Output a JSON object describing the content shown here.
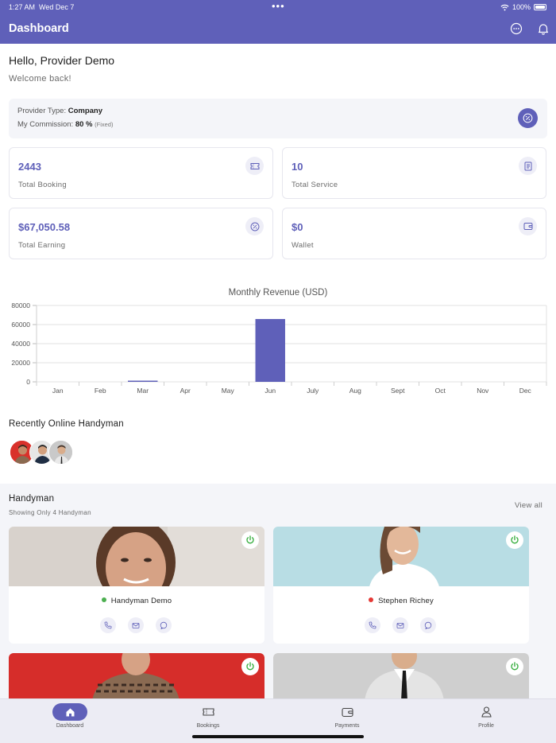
{
  "status_bar": {
    "time": "1:27 AM",
    "date": "Wed Dec 7",
    "battery": "100%"
  },
  "header": {
    "title": "Dashboard"
  },
  "greeting": {
    "hello": "Hello, Provider Demo",
    "welcome": "Welcome back!"
  },
  "provider": {
    "type_label": "Provider Type:",
    "type_value": "Company",
    "commission_label": "My Commission:",
    "commission_value": "80 %",
    "commission_note": "(Fixed)"
  },
  "stats": [
    {
      "value": "2443",
      "label": "Total Booking",
      "icon": "ticket-icon"
    },
    {
      "value": "10",
      "label": "Total Service",
      "icon": "document-icon"
    },
    {
      "value": "$67,050.58",
      "label": "Total Earning",
      "icon": "percent-badge-icon"
    },
    {
      "value": "$0",
      "label": "Wallet",
      "icon": "wallet-icon"
    }
  ],
  "chart_data": {
    "type": "bar",
    "title": "Monthly Revenue (USD)",
    "categories": [
      "Jan",
      "Feb",
      "Mar",
      "Apr",
      "May",
      "Jun",
      "July",
      "Aug",
      "Sept",
      "Oct",
      "Nov",
      "Dec"
    ],
    "values": [
      0,
      0,
      1200,
      0,
      0,
      65800,
      0,
      0,
      0,
      0,
      0,
      0
    ],
    "yticks": [
      "0",
      "20000",
      "40000",
      "60000",
      "80000"
    ],
    "ylim": [
      0,
      80000
    ],
    "grid": true,
    "color": "#5f60b9"
  },
  "recent": {
    "title": "Recently Online Handyman"
  },
  "handyman_section": {
    "title": "Handyman",
    "subtitle": "Showing Only 4 Handyman",
    "view_all": "View all"
  },
  "handymen": [
    {
      "name": "Handyman Demo",
      "status_color": "#4caf50"
    },
    {
      "name": "Stephen Richey",
      "status_color": "#e53935"
    },
    {
      "name": "",
      "status_color": ""
    },
    {
      "name": "",
      "status_color": ""
    }
  ],
  "tabs": [
    {
      "label": "Dashboard",
      "icon": "home-icon"
    },
    {
      "label": "Bookings",
      "icon": "ticket-icon"
    },
    {
      "label": "Payments",
      "icon": "wallet-icon"
    },
    {
      "label": "Profile",
      "icon": "user-icon"
    }
  ],
  "colors": {
    "primary": "#5f60b9",
    "online": "#4caf50",
    "offline": "#e53935",
    "power": "#3cb043"
  }
}
